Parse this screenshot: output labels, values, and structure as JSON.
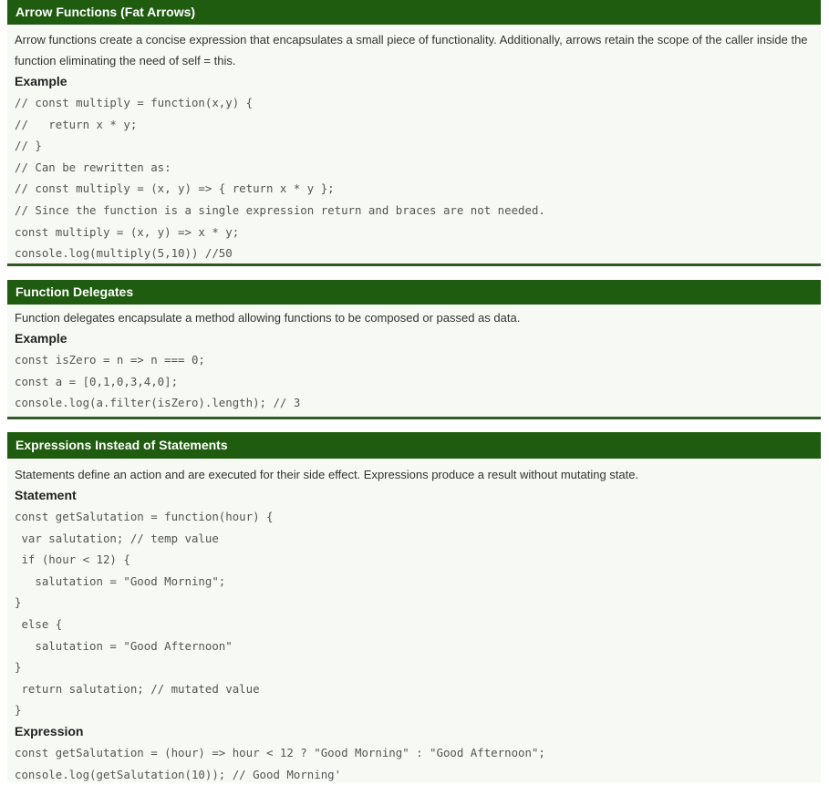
{
  "sections": [
    {
      "title": "Arrow Functions (Fat Arrows)",
      "description": "Arrow functions create a concise expression that encapsulates a small piece of functionality. Additionally, arrows retain the scope of the caller inside the function eliminating the need of self = this.",
      "example_label": "Example",
      "code": [
        "// const multiply = function(x,y) {",
        "//   return x * y;",
        "// }",
        "// Can be rewritten as:",
        "// const multiply = (x, y) => { return x * y };",
        "// Since the function is a single expression return and braces are not needed.",
        "const multiply = (x, y) => x * y;",
        "console.log(multiply(5,10)) //50"
      ]
    },
    {
      "title": "Function Delegates",
      "description": "Function delegates encapsulate a method allowing functions to be composed or passed as data.",
      "example_label": "Example",
      "code": [
        "const isZero = n => n === 0;",
        "const a = [0,1,0,3,4,0];",
        "console.log(a.filter(isZero).length); // 3"
      ]
    },
    {
      "title": "Expressions Instead of Statements",
      "description": "Statements define an action and are executed for their side effect. Expressions produce a result without mutating state.",
      "statement_label": "Statement",
      "statement_code": [
        "const getSalutation = function(hour) {",
        " var salutation; // temp value",
        " if (hour < 12) {",
        "   salutation = \"Good Morning\";",
        "}",
        " else {",
        "   salutation = \"Good Afternoon\"",
        "}",
        " return salutation; // mutated value",
        "}"
      ],
      "expression_label": "Expression",
      "expression_code": [
        "const getSalutation = (hour) => hour < 12 ? \"Good Morning\" : \"Good Afternoon\";",
        "console.log(getSalutation(10)); // Good Morning'"
      ]
    }
  ]
}
